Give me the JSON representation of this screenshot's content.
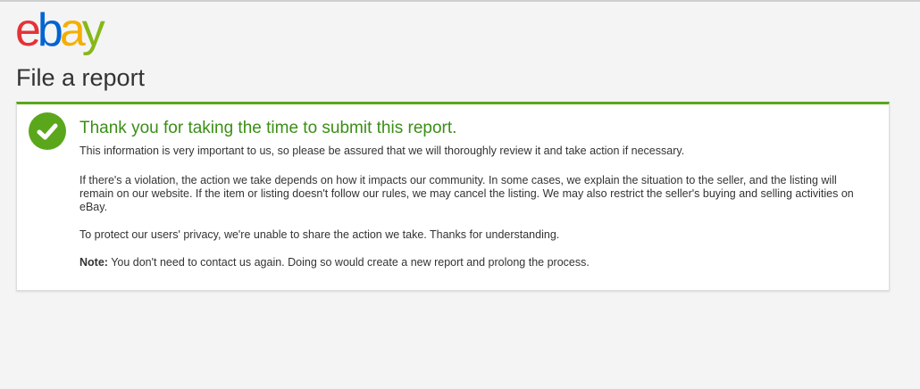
{
  "logo": {
    "letters": [
      "e",
      "b",
      "a",
      "y"
    ],
    "colors": [
      "#e53238",
      "#0064d2",
      "#f5af02",
      "#86b817"
    ]
  },
  "page": {
    "title": "File a report"
  },
  "confirmation": {
    "icon": "checkmark-icon",
    "accent_color": "#5ba71b",
    "heading": "Thank you for taking the time to submit this report.",
    "paragraph_1": "This information is very important to us, so please be assured that we will thoroughly review it and take action if necessary.",
    "paragraph_2": "If there's a violation, the action we take depends on how it impacts our community. In some cases, we explain the situation to the seller, and the listing will remain on our website. If the item or listing doesn't follow our rules, we may cancel the listing. We may also restrict the seller's buying and selling activities on eBay.",
    "paragraph_3": "To protect our users' privacy, we're unable to share the action we take. Thanks for understanding.",
    "note_label": "Note:",
    "note_text": "You don't need to contact us again. Doing so would create a new report and prolong the process."
  }
}
